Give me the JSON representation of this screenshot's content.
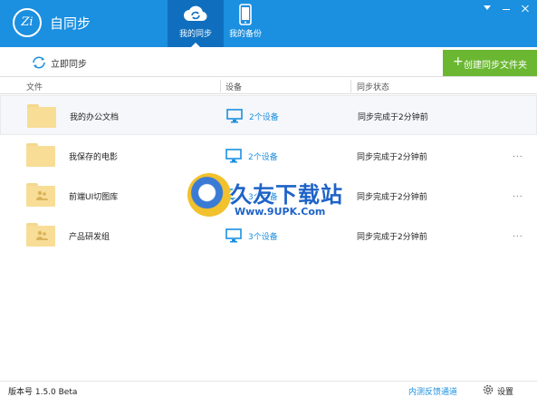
{
  "app": {
    "logo_text": "Zi",
    "title": "自同步"
  },
  "tabs": [
    {
      "label": "我的同步",
      "icon": "cloud-sync-icon",
      "active": true
    },
    {
      "label": "我的备份",
      "icon": "phone-icon",
      "active": false
    }
  ],
  "toolbar": {
    "sync_now_label": "立即同步",
    "create_folder_label": "创建同步文件夹",
    "create_folder_plus": "+",
    "accent_color": "#6bb732"
  },
  "table": {
    "headers": {
      "file": "文件",
      "device": "设备",
      "status": "同步状态"
    },
    "rows": [
      {
        "name": "我的办公文档",
        "folder_type": "folder-icon",
        "device": "2个设备",
        "status": "同步完成于2分钟前",
        "more": "..."
      },
      {
        "name": "我保存的电影",
        "folder_type": "folder-icon",
        "device": "2个设备",
        "status": "同步完成于2分钟前",
        "more": "..."
      },
      {
        "name": "前端UI切图库",
        "folder_type": "shared-folder-icon",
        "device": "3个设备",
        "status": "同步完成于2分钟前",
        "more": "..."
      },
      {
        "name": "产品研发组",
        "folder_type": "shared-folder-icon",
        "device": "3个设备",
        "status": "同步完成于2分钟前",
        "more": "..."
      }
    ]
  },
  "watermark": {
    "title": "久友下载站",
    "url": "Www.9UPK.Com"
  },
  "footer": {
    "version": "版本号 1.5.0 Beta",
    "feedback": "内测反馈通道",
    "settings": "设置"
  },
  "colors": {
    "title_bar": "#1b8fe0",
    "active_tab": "#0f6fbe",
    "link": "#1b8fe0"
  }
}
